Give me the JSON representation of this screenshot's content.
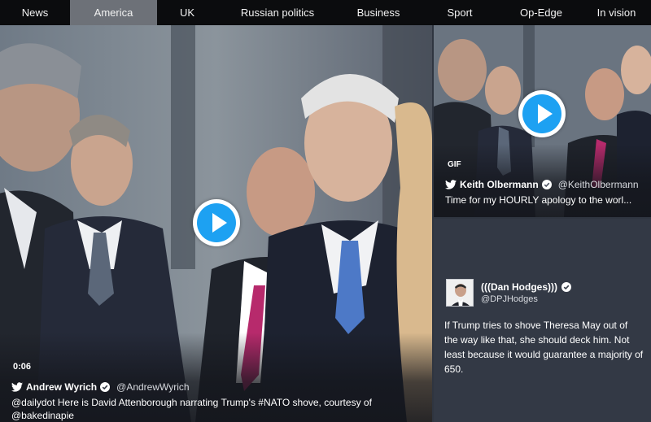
{
  "nav": {
    "items": [
      {
        "label": "News"
      },
      {
        "label": "America",
        "active": true
      },
      {
        "label": "UK"
      },
      {
        "label": "Russian politics"
      },
      {
        "label": "Business"
      },
      {
        "label": "Sport"
      },
      {
        "label": "Op-Edge"
      },
      {
        "label": "In vision"
      }
    ]
  },
  "colors": {
    "nav_bg": "#0b0c0e",
    "nav_active_bg": "#6d7178",
    "twitter_blue": "#1da1f2",
    "card_bg": "#333945"
  },
  "tiles": {
    "main": {
      "duration": "0:06",
      "author_name": "Andrew Wyrich",
      "handle": "@AndrewWyrich",
      "text": "@dailydot Here is David Attenborough narrating Trump's #NATO shove, courtesy of @bakedinapie",
      "play_icon": "play-icon"
    },
    "top_right": {
      "badge": "GIF",
      "author_name": "Keith Olbermann",
      "handle": "@KeithOlbermann",
      "text": "Time for my HOURLY apology to the worl..."
    },
    "bottom_right": {
      "author_name": "(((Dan Hodges)))",
      "handle": "@DPJHodges",
      "text": "If Trump tries to shove Theresa May out of the way like that, she should deck him. Not least because it would guarantee a majority of 650."
    }
  }
}
